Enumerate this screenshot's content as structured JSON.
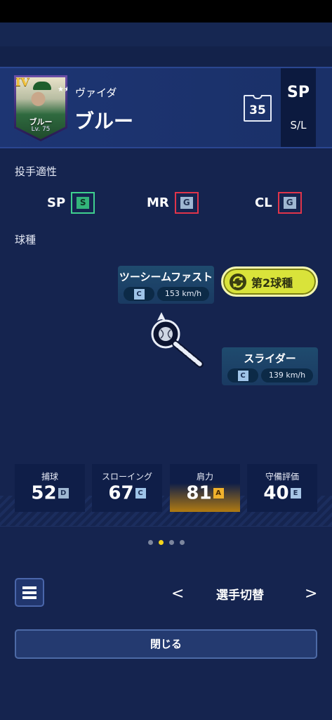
{
  "player": {
    "rank": "IV",
    "first_name": "ヴァイダ",
    "last_name": "ブルー",
    "portrait_name": "ブルー",
    "level": "Lv. 75",
    "stars": "★★★★★",
    "number": "35",
    "position": "SP",
    "bats_throws": "S/L"
  },
  "aptitude": {
    "label": "投手適性",
    "items": [
      {
        "role": "SP",
        "grade": "S"
      },
      {
        "role": "MR",
        "grade": "G"
      },
      {
        "role": "CL",
        "grade": "G"
      }
    ]
  },
  "pitches": {
    "label": "球種",
    "list": [
      {
        "name": "ツーシームファスト",
        "grade": "C",
        "speed": "153 km/h"
      },
      {
        "name": "スライダー",
        "grade": "C",
        "speed": "139 km/h"
      }
    ],
    "second_pitch_button": "第2球種"
  },
  "stats": [
    {
      "label": "捕球",
      "value": "52",
      "grade": "D",
      "grade_color": "#9fb7d2"
    },
    {
      "label": "スローイング",
      "value": "67",
      "grade": "C",
      "grade_color": "#9fc4e8"
    },
    {
      "label": "肩力",
      "value": "81",
      "grade": "A",
      "grade_color": "#f0b12c"
    },
    {
      "label": "守備評価",
      "value": "40",
      "grade": "E",
      "grade_color": "#a7c5e6"
    }
  ],
  "pagination": {
    "current": 2,
    "total": 4
  },
  "footer": {
    "prev": "<",
    "next": ">",
    "switch_label": "選手切替",
    "close_label": "閉じる"
  }
}
